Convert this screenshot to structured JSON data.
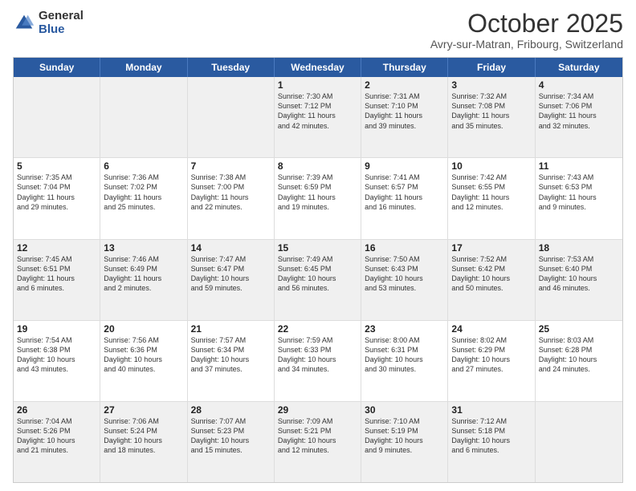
{
  "logo": {
    "general": "General",
    "blue": "Blue"
  },
  "title": "October 2025",
  "location": "Avry-sur-Matran, Fribourg, Switzerland",
  "days_of_week": [
    "Sunday",
    "Monday",
    "Tuesday",
    "Wednesday",
    "Thursday",
    "Friday",
    "Saturday"
  ],
  "weeks": [
    [
      {
        "day": "",
        "info": ""
      },
      {
        "day": "",
        "info": ""
      },
      {
        "day": "",
        "info": ""
      },
      {
        "day": "1",
        "info": "Sunrise: 7:30 AM\nSunset: 7:12 PM\nDaylight: 11 hours\nand 42 minutes."
      },
      {
        "day": "2",
        "info": "Sunrise: 7:31 AM\nSunset: 7:10 PM\nDaylight: 11 hours\nand 39 minutes."
      },
      {
        "day": "3",
        "info": "Sunrise: 7:32 AM\nSunset: 7:08 PM\nDaylight: 11 hours\nand 35 minutes."
      },
      {
        "day": "4",
        "info": "Sunrise: 7:34 AM\nSunset: 7:06 PM\nDaylight: 11 hours\nand 32 minutes."
      }
    ],
    [
      {
        "day": "5",
        "info": "Sunrise: 7:35 AM\nSunset: 7:04 PM\nDaylight: 11 hours\nand 29 minutes."
      },
      {
        "day": "6",
        "info": "Sunrise: 7:36 AM\nSunset: 7:02 PM\nDaylight: 11 hours\nand 25 minutes."
      },
      {
        "day": "7",
        "info": "Sunrise: 7:38 AM\nSunset: 7:00 PM\nDaylight: 11 hours\nand 22 minutes."
      },
      {
        "day": "8",
        "info": "Sunrise: 7:39 AM\nSunset: 6:59 PM\nDaylight: 11 hours\nand 19 minutes."
      },
      {
        "day": "9",
        "info": "Sunrise: 7:41 AM\nSunset: 6:57 PM\nDaylight: 11 hours\nand 16 minutes."
      },
      {
        "day": "10",
        "info": "Sunrise: 7:42 AM\nSunset: 6:55 PM\nDaylight: 11 hours\nand 12 minutes."
      },
      {
        "day": "11",
        "info": "Sunrise: 7:43 AM\nSunset: 6:53 PM\nDaylight: 11 hours\nand 9 minutes."
      }
    ],
    [
      {
        "day": "12",
        "info": "Sunrise: 7:45 AM\nSunset: 6:51 PM\nDaylight: 11 hours\nand 6 minutes."
      },
      {
        "day": "13",
        "info": "Sunrise: 7:46 AM\nSunset: 6:49 PM\nDaylight: 11 hours\nand 2 minutes."
      },
      {
        "day": "14",
        "info": "Sunrise: 7:47 AM\nSunset: 6:47 PM\nDaylight: 10 hours\nand 59 minutes."
      },
      {
        "day": "15",
        "info": "Sunrise: 7:49 AM\nSunset: 6:45 PM\nDaylight: 10 hours\nand 56 minutes."
      },
      {
        "day": "16",
        "info": "Sunrise: 7:50 AM\nSunset: 6:43 PM\nDaylight: 10 hours\nand 53 minutes."
      },
      {
        "day": "17",
        "info": "Sunrise: 7:52 AM\nSunset: 6:42 PM\nDaylight: 10 hours\nand 50 minutes."
      },
      {
        "day": "18",
        "info": "Sunrise: 7:53 AM\nSunset: 6:40 PM\nDaylight: 10 hours\nand 46 minutes."
      }
    ],
    [
      {
        "day": "19",
        "info": "Sunrise: 7:54 AM\nSunset: 6:38 PM\nDaylight: 10 hours\nand 43 minutes."
      },
      {
        "day": "20",
        "info": "Sunrise: 7:56 AM\nSunset: 6:36 PM\nDaylight: 10 hours\nand 40 minutes."
      },
      {
        "day": "21",
        "info": "Sunrise: 7:57 AM\nSunset: 6:34 PM\nDaylight: 10 hours\nand 37 minutes."
      },
      {
        "day": "22",
        "info": "Sunrise: 7:59 AM\nSunset: 6:33 PM\nDaylight: 10 hours\nand 34 minutes."
      },
      {
        "day": "23",
        "info": "Sunrise: 8:00 AM\nSunset: 6:31 PM\nDaylight: 10 hours\nand 30 minutes."
      },
      {
        "day": "24",
        "info": "Sunrise: 8:02 AM\nSunset: 6:29 PM\nDaylight: 10 hours\nand 27 minutes."
      },
      {
        "day": "25",
        "info": "Sunrise: 8:03 AM\nSunset: 6:28 PM\nDaylight: 10 hours\nand 24 minutes."
      }
    ],
    [
      {
        "day": "26",
        "info": "Sunrise: 7:04 AM\nSunset: 5:26 PM\nDaylight: 10 hours\nand 21 minutes."
      },
      {
        "day": "27",
        "info": "Sunrise: 7:06 AM\nSunset: 5:24 PM\nDaylight: 10 hours\nand 18 minutes."
      },
      {
        "day": "28",
        "info": "Sunrise: 7:07 AM\nSunset: 5:23 PM\nDaylight: 10 hours\nand 15 minutes."
      },
      {
        "day": "29",
        "info": "Sunrise: 7:09 AM\nSunset: 5:21 PM\nDaylight: 10 hours\nand 12 minutes."
      },
      {
        "day": "30",
        "info": "Sunrise: 7:10 AM\nSunset: 5:19 PM\nDaylight: 10 hours\nand 9 minutes."
      },
      {
        "day": "31",
        "info": "Sunrise: 7:12 AM\nSunset: 5:18 PM\nDaylight: 10 hours\nand 6 minutes."
      },
      {
        "day": "",
        "info": ""
      }
    ]
  ]
}
